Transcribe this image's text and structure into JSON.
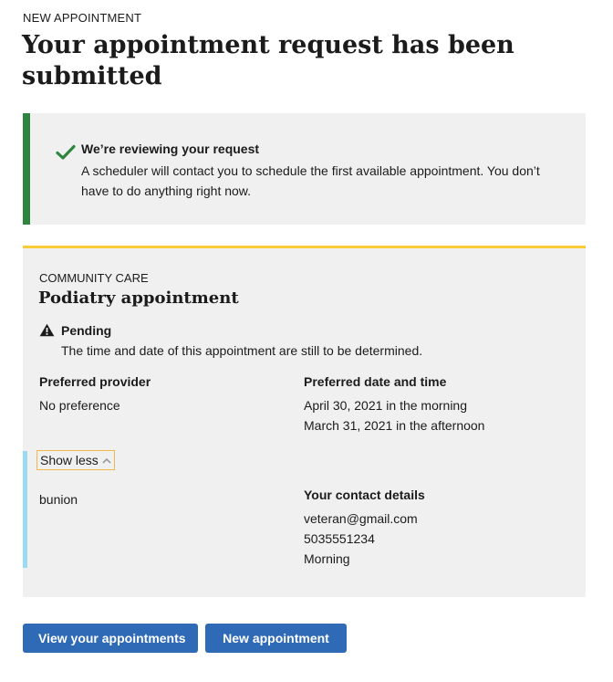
{
  "header": {
    "eyebrow": "NEW APPOINTMENT",
    "title": "Your appointment request has been submitted"
  },
  "alert": {
    "status": "success",
    "icon": "check-icon",
    "color": "#2e8540",
    "heading": "We’re reviewing your request",
    "body": "A scheduler will contact you to schedule the first available appointment. You don’t have to do anything right now."
  },
  "appointment": {
    "eyebrow": "COMMUNITY CARE",
    "title": "Podiatry appointment",
    "status_icon": "warning-icon",
    "status_label": "Pending",
    "status_text": "The time and date of this appointment are still to be determined.",
    "provider": {
      "heading": "Preferred provider",
      "value": "No preference"
    },
    "preferred_dates": {
      "heading": "Preferred date and time",
      "values": [
        "April 30, 2021 in the morning",
        "March 31, 2021 in the afternoon"
      ]
    },
    "toggle_label": "Show less",
    "reason": "bunion",
    "contact": {
      "heading": "Your contact details",
      "email": "veteran@gmail.com",
      "phone": "5035551234",
      "best_time": "Morning"
    },
    "accent_color": "#facc36"
  },
  "actions": {
    "view_label": "View your appointments",
    "new_label": "New appointment",
    "button_color": "#2e6ab6"
  }
}
